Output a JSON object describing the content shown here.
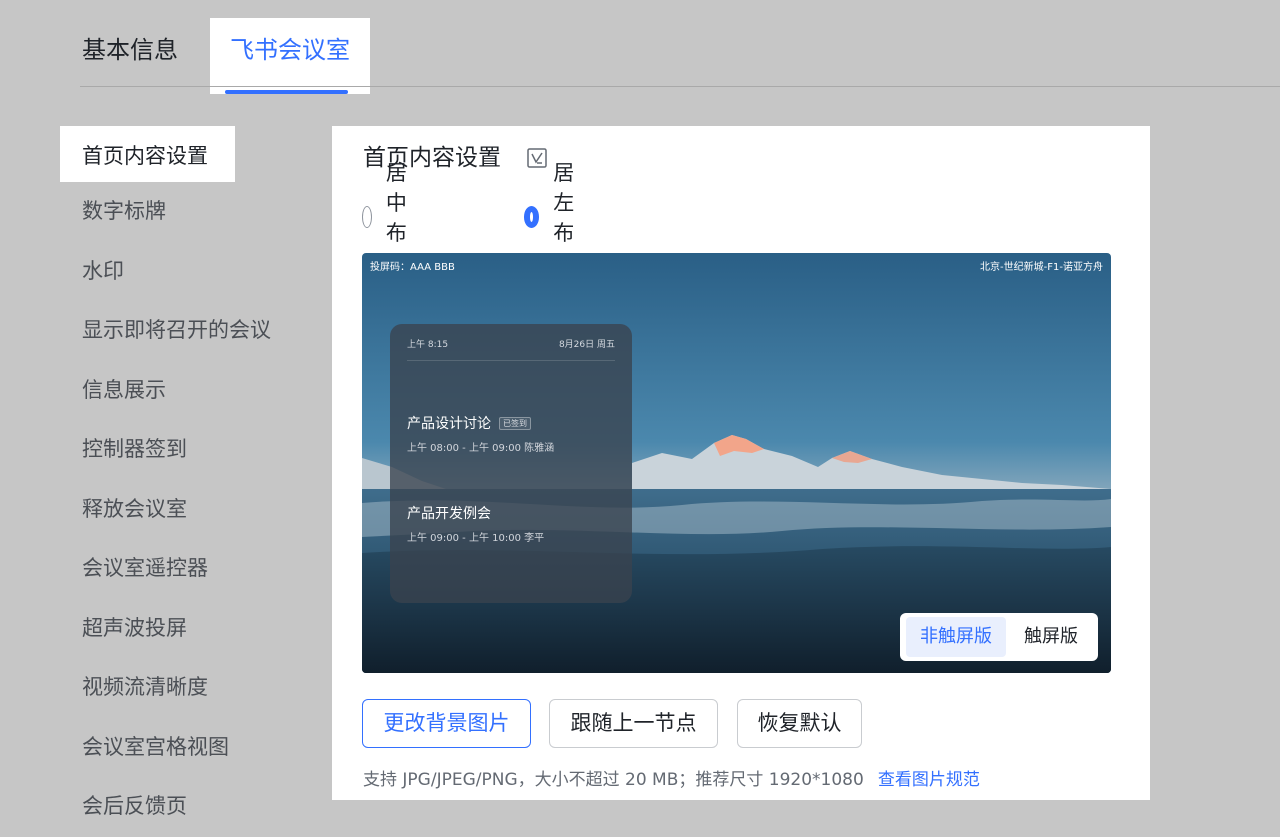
{
  "tabs": [
    {
      "label": "基本信息",
      "active": false
    },
    {
      "label": "飞书会议室",
      "active": true
    }
  ],
  "sidebar": {
    "items": [
      {
        "label": "首页内容设置",
        "active": true
      },
      {
        "label": "数字标牌"
      },
      {
        "label": "水印"
      },
      {
        "label": "显示即将召开的会议"
      },
      {
        "label": "信息展示"
      },
      {
        "label": "控制器签到"
      },
      {
        "label": "释放会议室"
      },
      {
        "label": "会议室遥控器"
      },
      {
        "label": "超声波投屏"
      },
      {
        "label": "视频流清晰度"
      },
      {
        "label": "会议室宫格视图"
      },
      {
        "label": "会后反馈页"
      }
    ]
  },
  "panel": {
    "title": "首页内容设置",
    "layout_options": [
      {
        "label": "居中布局",
        "checked": false
      },
      {
        "label": "居左布局",
        "checked": true
      }
    ],
    "preview": {
      "cast_code": "投屏码：AAA BBB",
      "room_name": "北京-世纪新城-F1-诺亚方舟",
      "time": "上午 8:15",
      "date": "8月26日 周五",
      "meetings": [
        {
          "title": "产品设计讨论",
          "badge": "已签到",
          "detail": "上午 08:00 - 上午 09:00   陈雅涵"
        },
        {
          "title": "产品开发例会",
          "detail": "上午 09:00 - 上午 10:00   李平"
        }
      ],
      "mode_options": [
        {
          "label": "非触屏版",
          "selected": true
        },
        {
          "label": "触屏版",
          "selected": false
        }
      ]
    },
    "buttons": {
      "change_bg": "更改背景图片",
      "follow_parent": "跟随上一节点",
      "reset_default": "恢复默认"
    },
    "hint": "支持 JPG/JPEG/PNG，大小不超过 20 MB；推荐尺寸 1920*1080",
    "hint_link": "查看图片规范"
  },
  "colors": {
    "accent": "#3370ff",
    "background": "#c6c6c6"
  }
}
